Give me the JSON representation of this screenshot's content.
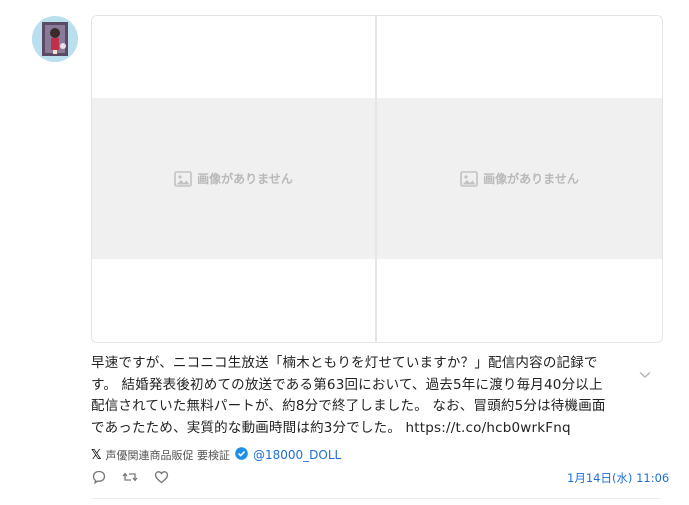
{
  "tweet": {
    "text": "早速ですが、ニコニコ生放送「楠木ともりを灯せていますか？」配信内容の記録です。 結婚発表後初めての放送である第63回において、過去5年に渡り毎月40分以上配信されていた無料パートが、約8分で終了しました。 なお、冒頭約5分は待機画面であったため、実質的な動画時間は約3分でした。 ",
    "link": "https://t.co/hcb0wrkFnq"
  },
  "media": {
    "left_placeholder": "画像がありません",
    "right_placeholder": "画像がありません"
  },
  "source": {
    "logo": "𝕏",
    "name": "声優関連商品販促 要検証",
    "handle": "@18000_DOLL"
  },
  "timestamp": "1月14日(水) 11:06",
  "icons": {
    "avatar": "avatar",
    "image_placeholder": "image-icon",
    "more": "chevron-down-icon",
    "verified": "verified-icon",
    "reply": "reply-icon",
    "retweet": "retweet-icon",
    "like": "like-icon"
  },
  "colors": {
    "link_blue": "#1d6fd6",
    "verified_blue": "#1d8fe8",
    "placeholder_bg": "#f0f0f0"
  }
}
